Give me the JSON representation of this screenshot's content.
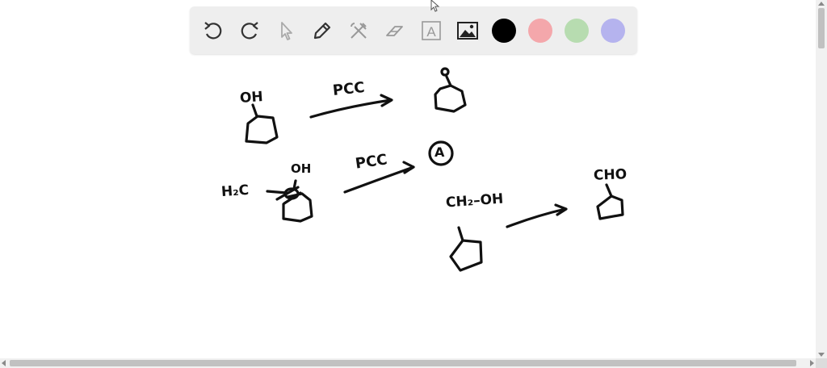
{
  "toolbar": {
    "tools": [
      {
        "icon": "undo-icon"
      },
      {
        "icon": "redo-icon"
      },
      {
        "icon": "select-pointer-icon"
      },
      {
        "icon": "pen-icon"
      },
      {
        "icon": "tools-icon"
      },
      {
        "icon": "eraser-icon"
      },
      {
        "icon": "text-icon",
        "glyph": "A"
      },
      {
        "icon": "image-icon"
      }
    ],
    "colors": [
      "#000000",
      "#f4a7ab",
      "#b7dcb0",
      "#b5b3ee"
    ],
    "selected_color": "#000000"
  },
  "canvas": {
    "reaction1": {
      "reactant_label": "OH",
      "reagent": "PCC"
    },
    "reaction2": {
      "substituent": "H₂C",
      "reactant_label": "OH",
      "reagent": "PCC",
      "product": "A"
    },
    "reaction3": {
      "reactant_label": "CH₂–OH",
      "product_label": "CHO"
    }
  }
}
